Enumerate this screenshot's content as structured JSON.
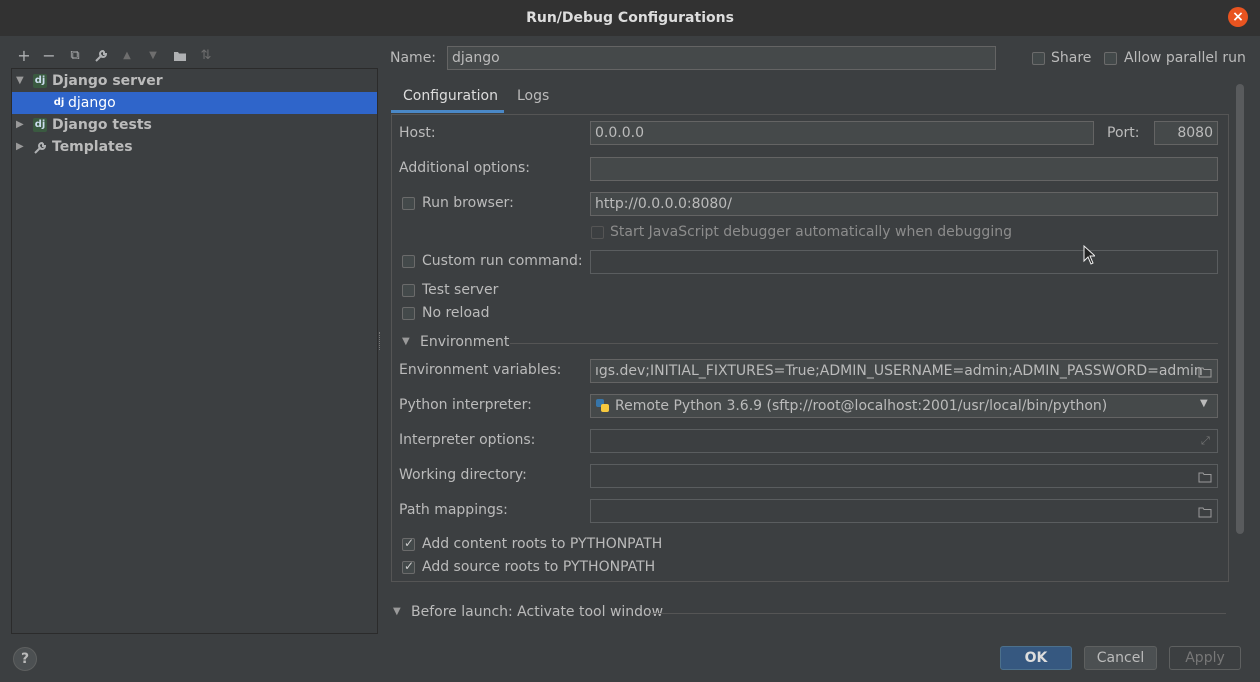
{
  "window": {
    "title": "Run/Debug Configurations"
  },
  "toolbar": {
    "add": "+",
    "remove": "−",
    "copy": "⧉",
    "edit": "🔧",
    "up": "▲",
    "down": "▼",
    "folder": "▭",
    "sort": "⇅"
  },
  "tree": {
    "items": [
      {
        "label": "Django server",
        "icon": "dj",
        "expanded": true
      },
      {
        "label": "django",
        "icon": "dj",
        "selected": true
      },
      {
        "label": "Django tests",
        "icon": "dj",
        "expanded": false
      },
      {
        "label": "Templates",
        "icon": "wrench",
        "expanded": false
      }
    ]
  },
  "header": {
    "name_label": "Name:",
    "name_value": "django",
    "share_label": "Share",
    "parallel_label": "Allow parallel run"
  },
  "tabs": [
    "Configuration",
    "Logs"
  ],
  "config": {
    "host_label": "Host:",
    "host_value": "0.0.0.0",
    "port_label": "Port:",
    "port_value": "8080",
    "additional_label": "Additional options:",
    "additional_value": "",
    "run_browser_label": "Run browser:",
    "run_browser_value": "http://0.0.0.0:8080/",
    "js_debugger_label": "Start JavaScript debugger automatically when debugging",
    "custom_cmd_label": "Custom run command:",
    "custom_cmd_value": "",
    "test_server_label": "Test server",
    "no_reload_label": "No reload",
    "environment_section": "Environment",
    "env_vars_label": "Environment variables:",
    "env_vars_value": "ıgs.dev;INITIAL_FIXTURES=True;ADMIN_USERNAME=admin;ADMIN_PASSWORD=admin",
    "interpreter_label": "Python interpreter:",
    "interpreter_value": "Remote Python 3.6.9 (sftp://root@localhost:2001/usr/local/bin/python)",
    "interp_options_label": "Interpreter options:",
    "working_dir_label": "Working directory:",
    "path_mappings_label": "Path mappings:",
    "content_roots_label": "Add content roots to PYTHONPATH",
    "source_roots_label": "Add source roots to PYTHONPATH"
  },
  "before_launch": {
    "label": "Before launch: Activate tool window"
  },
  "buttons": {
    "help": "?",
    "ok": "OK",
    "cancel": "Cancel",
    "apply": "Apply"
  },
  "colors": {
    "accent": "#2f65ca",
    "close": "#e95420",
    "primary_button": "#365880"
  }
}
